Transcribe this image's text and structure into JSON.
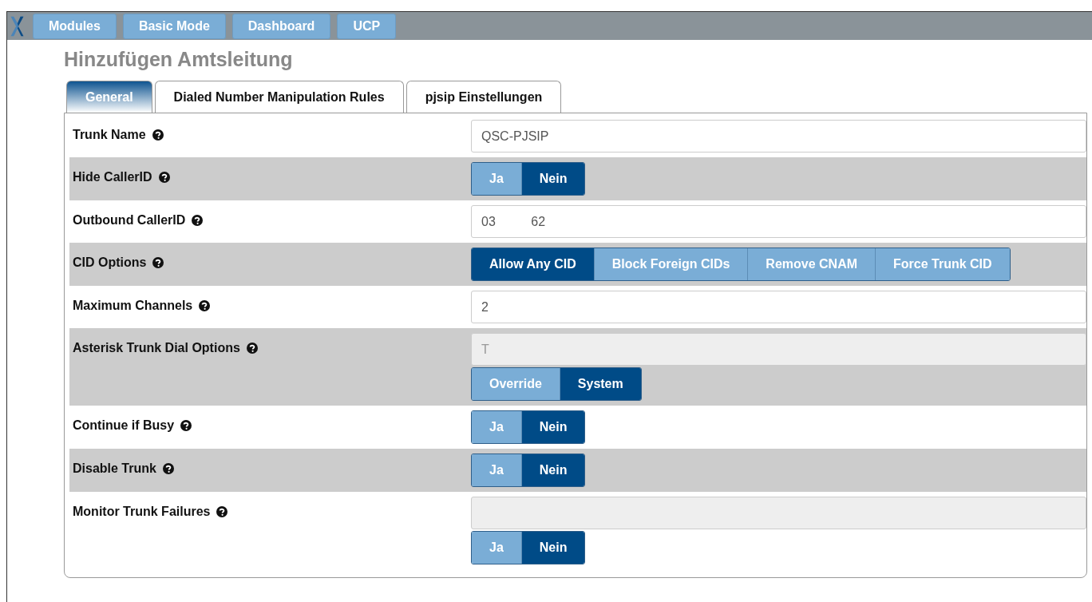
{
  "top_bar": {
    "buttons": [
      "Modules",
      "Basic Mode",
      "Dashboard",
      "UCP"
    ]
  },
  "page_title": "Hinzufügen Amtsleitung",
  "tabs": [
    {
      "label": "General",
      "selected": true
    },
    {
      "label": "Dialed Number Manipulation Rules",
      "selected": false
    },
    {
      "label": "pjsip Einstellungen",
      "selected": false
    }
  ],
  "form_rows": [
    {
      "label": "Trunk Name",
      "kind": "text",
      "value": "QSC-PJSIP"
    },
    {
      "label": "Hide CallerID",
      "kind": "toggle",
      "options": [
        {
          "label": "Ja",
          "selected": false
        },
        {
          "label": "Nein",
          "selected": true
        }
      ]
    },
    {
      "label": "Outbound CallerID",
      "kind": "text",
      "value": "03          62"
    },
    {
      "label": "CID Options",
      "kind": "toggle",
      "options": [
        {
          "label": "Allow Any CID",
          "selected": true
        },
        {
          "label": "Block Foreign CIDs",
          "selected": false
        },
        {
          "label": "Remove CNAM",
          "selected": false
        },
        {
          "label": "Force Trunk CID",
          "selected": false
        }
      ]
    },
    {
      "label": "Maximum Channels",
      "kind": "text",
      "value": "2"
    },
    {
      "label": "Asterisk Trunk Dial Options",
      "kind": "text_toggle",
      "value": "T",
      "disabled": true,
      "options": [
        {
          "label": "Override",
          "selected": false
        },
        {
          "label": "System",
          "selected": true
        }
      ]
    },
    {
      "label": "Continue if Busy",
      "kind": "toggle",
      "options": [
        {
          "label": "Ja",
          "selected": false
        },
        {
          "label": "Nein",
          "selected": true
        }
      ]
    },
    {
      "label": "Disable Trunk",
      "kind": "toggle",
      "options": [
        {
          "label": "Ja",
          "selected": false
        },
        {
          "label": "Nein",
          "selected": true
        }
      ]
    },
    {
      "label": "Monitor Trunk Failures",
      "kind": "text_toggle",
      "disabled": true,
      "options": [
        {
          "label": "Ja",
          "selected": false
        },
        {
          "label": "Nein",
          "selected": true
        }
      ]
    }
  ]
}
